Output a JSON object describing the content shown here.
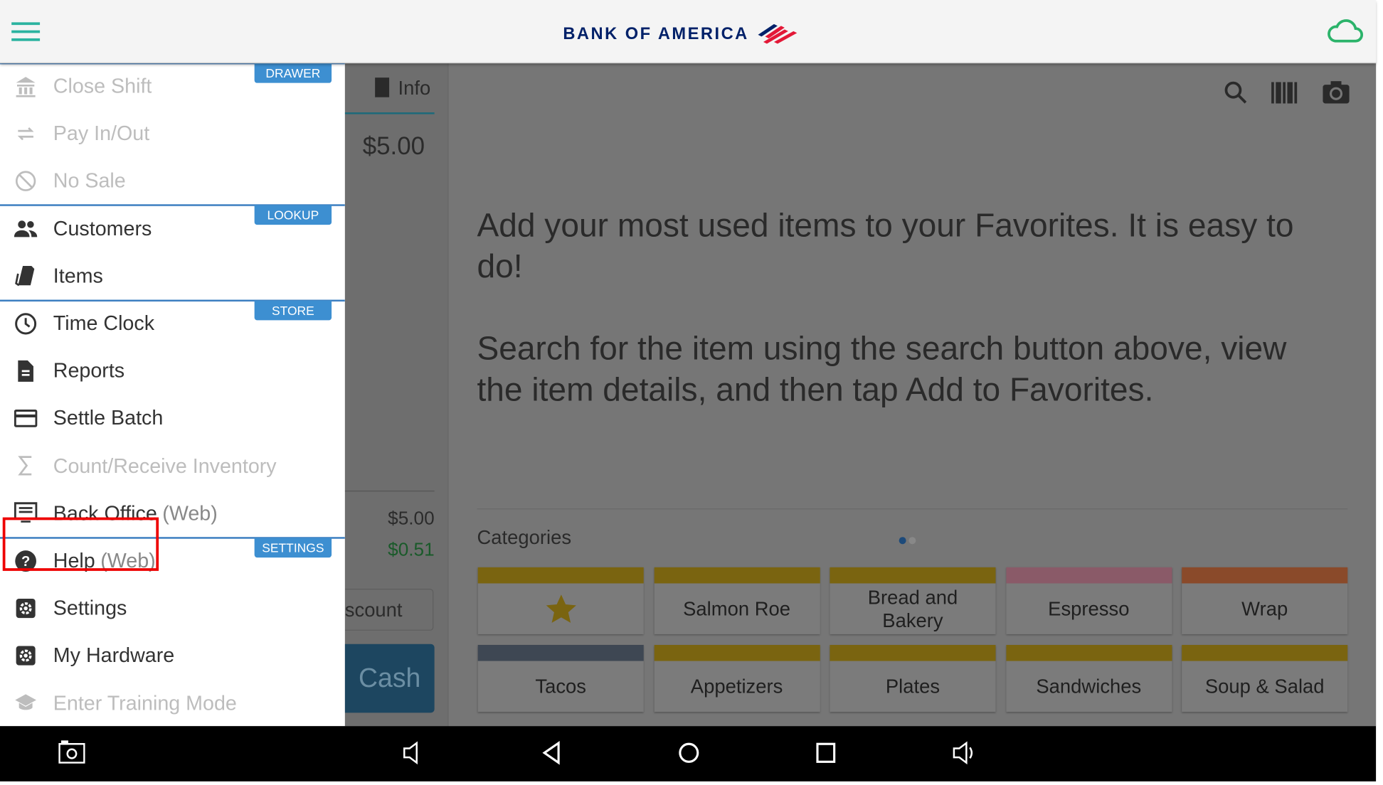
{
  "header": {
    "logo_text": "BANK OF AMERICA",
    "menu_icon": "hamburger-icon",
    "status_icon": "cloud-icon",
    "accent": "#2bb3a0"
  },
  "drawer": {
    "sections": [
      {
        "label": "DRAWER"
      },
      {
        "label": "LOOKUP"
      },
      {
        "label": "STORE"
      },
      {
        "label": "SETTINGS"
      }
    ],
    "items": [
      {
        "label": "Close Shift",
        "icon": "bank-icon",
        "enabled": false
      },
      {
        "label": "Pay In/Out",
        "icon": "swap-arrows-icon",
        "enabled": false
      },
      {
        "label": "No Sale",
        "icon": "prohibited-icon",
        "enabled": false
      },
      {
        "label": "Customers",
        "icon": "people-icon",
        "enabled": true
      },
      {
        "label": "Items",
        "icon": "tags-icon",
        "enabled": true
      },
      {
        "label": "Time Clock",
        "icon": "clock-icon",
        "enabled": true
      },
      {
        "label": "Reports",
        "icon": "document-icon",
        "enabled": true
      },
      {
        "label": "Settle Batch",
        "icon": "credit-card-icon",
        "enabled": true
      },
      {
        "label": "Count/Receive Inventory",
        "icon": "sigma-icon",
        "enabled": false
      },
      {
        "label": "Back Office",
        "suffix": "(Web)",
        "icon": "monitor-icon",
        "enabled": true
      },
      {
        "label": "Help",
        "suffix": "(Web)",
        "icon": "help-icon",
        "enabled": true
      },
      {
        "label": "Settings",
        "icon": "gear-icon",
        "enabled": true,
        "highlighted": true
      },
      {
        "label": "My Hardware",
        "icon": "gear-icon",
        "enabled": true
      },
      {
        "label": "Enter Training Mode",
        "icon": "graduation-cap-icon",
        "enabled": false
      }
    ]
  },
  "order": {
    "info_label": "Info",
    "total": "$5.00",
    "subtotal": "$5.00",
    "tax": "$0.51",
    "discount_label": "scount",
    "cash_label": "Cash"
  },
  "favorites": {
    "message1": "Add your most used items to your Favorites. It is easy to do!",
    "message2": "Search for the item using the search button above, view the item details, and then tap Add to Favorites."
  },
  "categories": {
    "title": "Categories",
    "page": 1,
    "pages": 2,
    "tiles": [
      {
        "label": "",
        "icon": "star-icon",
        "color": "#7a6410"
      },
      {
        "label": "Salmon Roe",
        "color": "#7a6410"
      },
      {
        "label": "Bread and Bakery",
        "color": "#7a6410"
      },
      {
        "label": "Espresso",
        "color": "#8a5a68"
      },
      {
        "label": "Wrap",
        "color": "#8a4a2a"
      },
      {
        "label": "Tacos",
        "color": "#3e4753"
      },
      {
        "label": "Appetizers",
        "color": "#7a6410"
      },
      {
        "label": "Plates",
        "color": "#7a6410"
      },
      {
        "label": "Sandwiches",
        "color": "#7a6410"
      },
      {
        "label": "Soup & Salad",
        "color": "#7a6410"
      }
    ]
  }
}
